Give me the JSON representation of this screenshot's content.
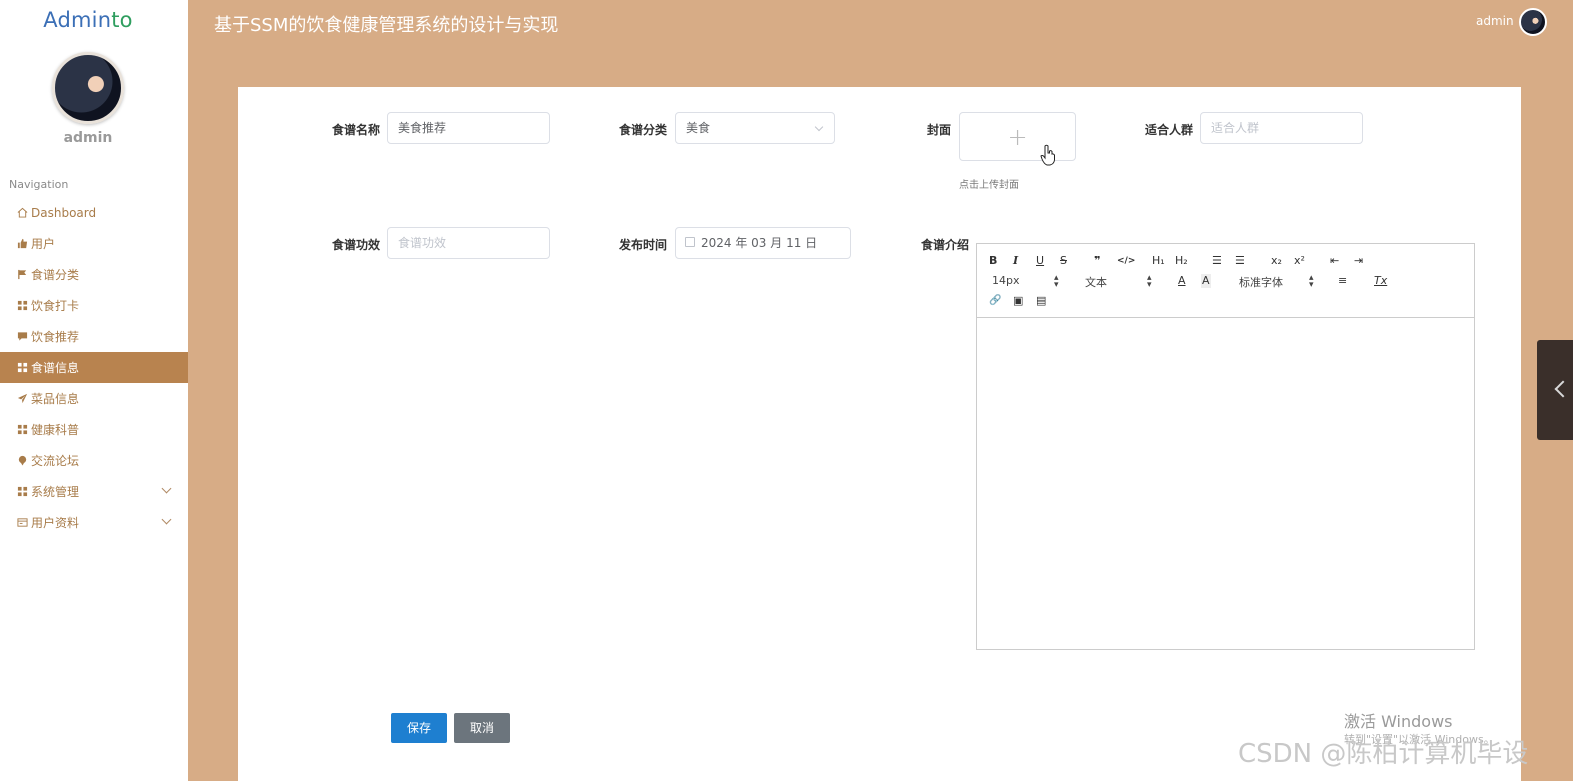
{
  "sidebar": {
    "brand_part1": "Admin",
    "brand_part2": "to",
    "username": "admin",
    "nav_heading": "Navigation",
    "items": [
      {
        "label": "Dashboard",
        "icon": "home-icon"
      },
      {
        "label": "用户",
        "icon": "thumbs-up-icon"
      },
      {
        "label": "食谱分类",
        "icon": "flag-icon"
      },
      {
        "label": "饮食打卡",
        "icon": "grid-icon"
      },
      {
        "label": "饮食推荐",
        "icon": "comment-icon"
      },
      {
        "label": "食谱信息",
        "icon": "grid-icon",
        "active": true
      },
      {
        "label": "菜品信息",
        "icon": "send-icon"
      },
      {
        "label": "健康科普",
        "icon": "grid-icon"
      },
      {
        "label": "交流论坛",
        "icon": "map-pin-icon"
      },
      {
        "label": "系统管理",
        "icon": "grid-icon",
        "expandable": true
      },
      {
        "label": "用户资料",
        "icon": "id-card-icon",
        "expandable": true
      }
    ]
  },
  "header": {
    "title": "基于SSM的饮食健康管理系统的设计与实现",
    "user": "admin"
  },
  "form": {
    "name_label": "食谱名称",
    "name_value": "美食推荐",
    "category_label": "食谱分类",
    "category_value": "美食",
    "cover_label": "封面",
    "upload_plus": "+",
    "upload_tip": "点击上传封面",
    "audience_label": "适合人群",
    "audience_placeholder": "适合人群",
    "effect_label": "食谱功效",
    "effect_placeholder": "食谱功效",
    "time_label": "发布时间",
    "time_value": "2024 年 03 月 11 日",
    "intro_label": "食谱介绍"
  },
  "editor": {
    "bold": "B",
    "italic": "I",
    "underline": "U",
    "strike": "S",
    "quote": "❞",
    "code": "</>",
    "h1": "H₁",
    "h2": "H₂",
    "ordered_list": "☰",
    "bullet_list": "☰",
    "subscript": "x₂",
    "superscript": "x²",
    "outdent": "⇤",
    "indent": "⇥",
    "size": "14px",
    "text_type": "文本",
    "font_color": "A",
    "bg_color": "A",
    "font_family": "标准字体",
    "align": "≡",
    "clear": "Tx",
    "link": "🔗",
    "image": "▣",
    "video": "▤"
  },
  "buttons": {
    "save": "保存",
    "cancel": "取消"
  },
  "watermarks": {
    "activate": "激活 Windows",
    "activate_sub": "转到\"设置\"以激活 Windows。",
    "csdn": "CSDN @陈柏计算机毕设"
  },
  "colors": {
    "background": "#d7ac86",
    "active_nav": "#b8834f",
    "nav_text": "#a87c4a",
    "save_button": "#1e7fd0",
    "cancel_button": "#6c757d"
  }
}
